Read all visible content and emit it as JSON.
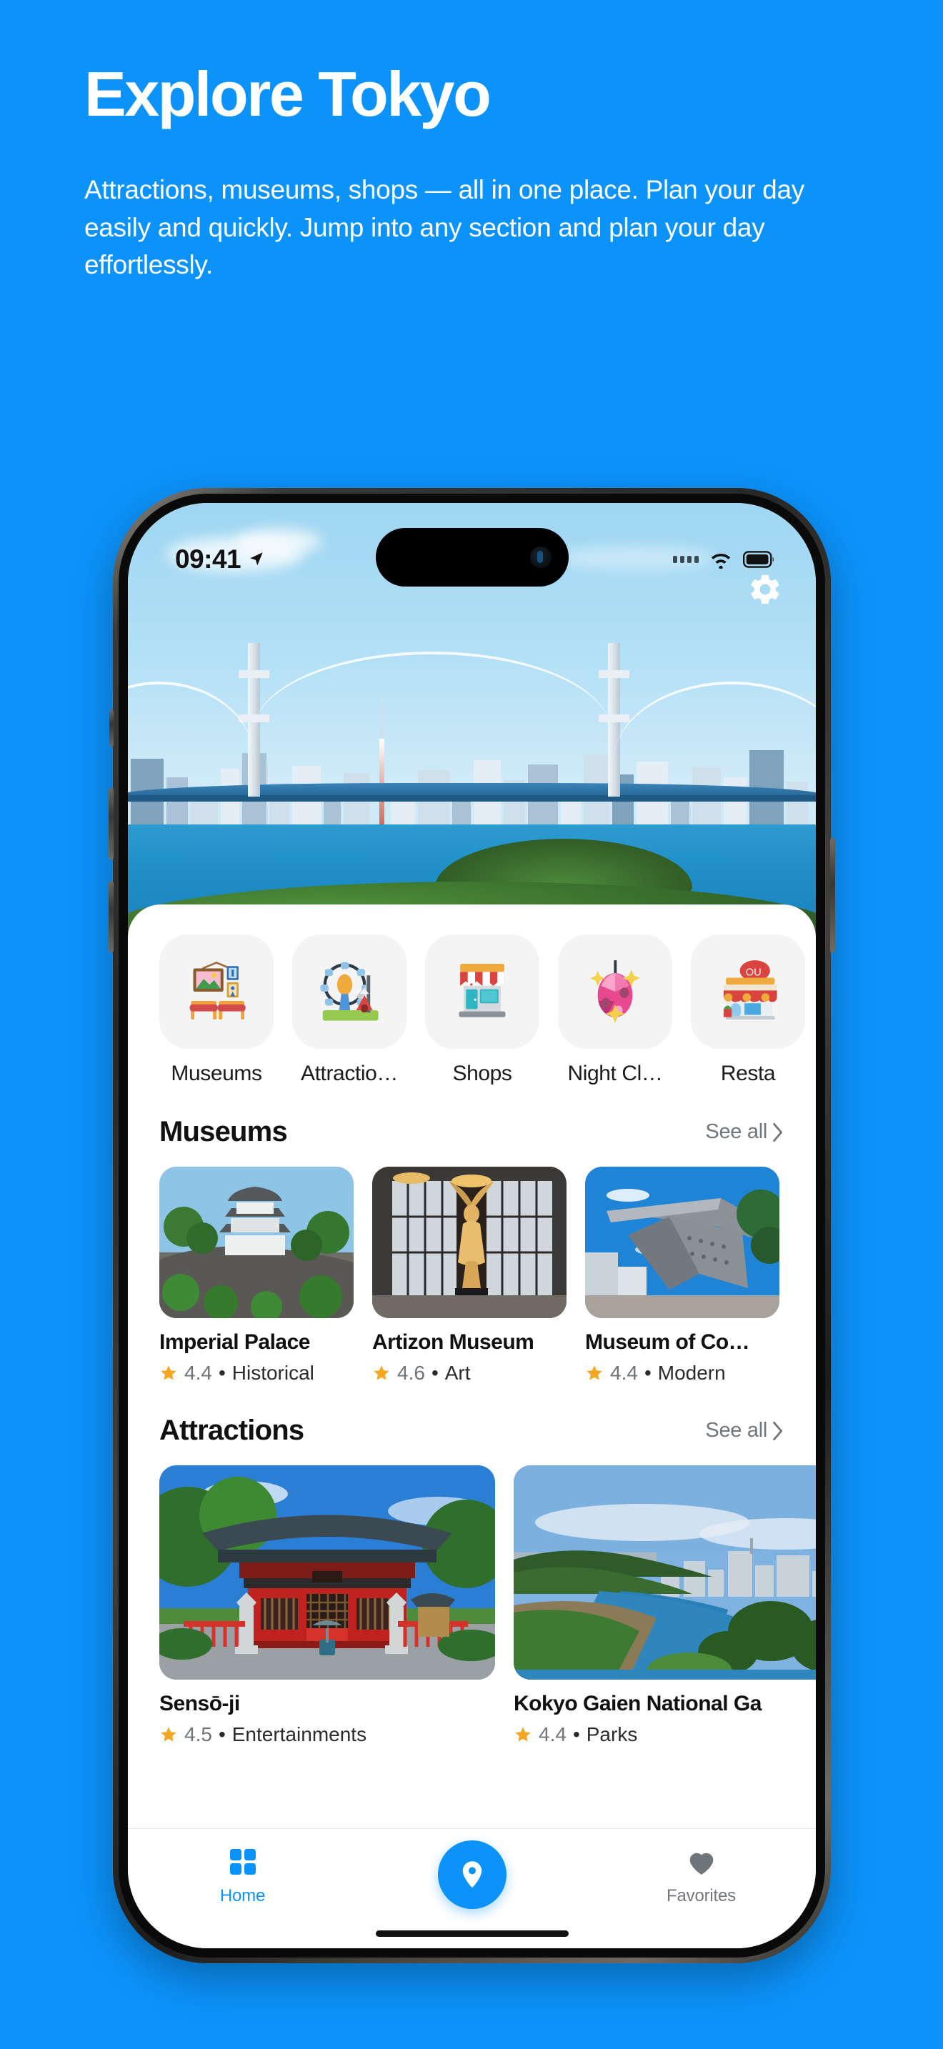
{
  "theme": {
    "background": "#0c93fb",
    "accent": "#0c93fb",
    "star": "#f5a623",
    "sheet": "#ffffff"
  },
  "promo": {
    "title": "Explore Tokyo",
    "subtitle": "Attractions, museums, shops — all in one place. Plan your day easily and quickly. Jump into any section and plan your day effortlessly."
  },
  "status_bar": {
    "time": "09:41",
    "location_icon": "location-arrow-icon",
    "signal_icon": "cellular-dots-icon",
    "wifi_icon": "wifi-icon",
    "battery_icon": "battery-icon"
  },
  "hero": {
    "image_alt": "Rainbow Bridge and Tokyo Bay skyline",
    "settings_icon": "gear-icon"
  },
  "categories": [
    {
      "label": "Museums",
      "icon": "framed-pictures-icon"
    },
    {
      "label": "Attractio…",
      "icon": "ferris-wheel-icon"
    },
    {
      "label": "Shops",
      "icon": "storefront-icon"
    },
    {
      "label": "Night Cl…",
      "icon": "disco-ball-icon"
    },
    {
      "label": "Resta",
      "icon": "restaurant-icon"
    }
  ],
  "sections": [
    {
      "title": "Museums",
      "see_all": "See all",
      "chevron": "chevron-right-icon",
      "cards": [
        {
          "title": "Imperial Palace",
          "rating": "4.4",
          "sep": "•",
          "category": "Historical",
          "image_alt": "Imperial Palace castle turret on stone wall"
        },
        {
          "title": "Artizon Museum",
          "rating": "4.6",
          "sep": "•",
          "category": "Art",
          "image_alt": "Golden winged statue in museum gallery"
        },
        {
          "title": "Museum of Co…",
          "rating": "4.4",
          "sep": "•",
          "category": "Modern",
          "image_alt": "Angular grey steel sculpture under blue sky"
        }
      ]
    },
    {
      "title": "Attractions",
      "see_all": "See all",
      "chevron": "chevron-right-icon",
      "cards": [
        {
          "title": "Sensō-ji",
          "rating": "4.5",
          "sep": "•",
          "category": "Entertainments",
          "image_alt": "Red temple hall with stone lanterns"
        },
        {
          "title": "Kokyo Gaien National Ga",
          "rating": "4.4",
          "sep": "•",
          "category": "Parks",
          "image_alt": "Palace moat with trees and city skyline"
        }
      ]
    }
  ],
  "tabbar": [
    {
      "label": "Home",
      "icon": "grid-icon",
      "state": "active"
    },
    {
      "label": "",
      "icon": "map-pin-icon",
      "state": "fab"
    },
    {
      "label": "Favorites",
      "icon": "heart-icon",
      "state": "inactive"
    }
  ]
}
